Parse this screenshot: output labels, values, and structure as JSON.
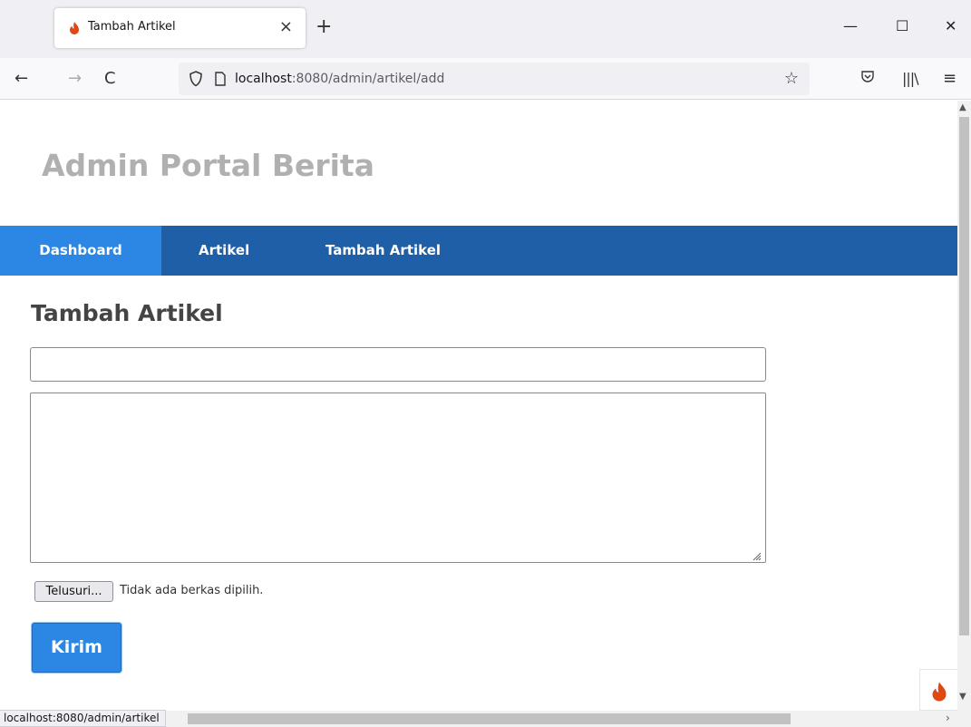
{
  "browser": {
    "tab_title": "Tambah Artikel",
    "tab_close": "×",
    "new_tab": "+",
    "window": {
      "minimize": "—",
      "maximize": "☐",
      "close": "✕"
    },
    "nav": {
      "back": "←",
      "forward": "→",
      "reload": "C"
    },
    "url_host": "localhost",
    "url_rest": ":8080/admin/artikel/add",
    "bookmark_star": "☆",
    "library": "|||\\",
    "menu": "≡",
    "status_url": "localhost:8080/admin/artikel"
  },
  "site": {
    "title": "Admin Portal Berita"
  },
  "menu": {
    "items": [
      {
        "label": "Dashboard",
        "active": true
      },
      {
        "label": "Artikel",
        "active": false
      },
      {
        "label": "Tambah Artikel",
        "active": false
      }
    ]
  },
  "form": {
    "heading": "Tambah Artikel",
    "title_value": "",
    "body_value": "",
    "file_button": "Telusuri...",
    "file_status": "Tidak ada berkas dipilih.",
    "submit": "Kirim"
  },
  "colors": {
    "menu_bg": "#1f5fa8",
    "menu_active": "#2b87e3",
    "submit_bg": "#2b87e3",
    "favicon": "#dd4814"
  }
}
